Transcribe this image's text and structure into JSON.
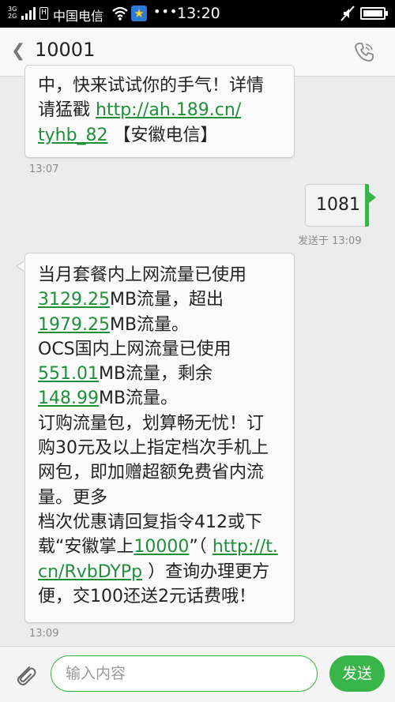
{
  "status_bar": {
    "network_top": "3G",
    "network_bottom": "2G",
    "sim_label": "H",
    "carrier": "中国电信",
    "more": "•••",
    "time": "13:20"
  },
  "header": {
    "back_icon": "chevron-left",
    "title": "10001",
    "call_icon": "phone-icon"
  },
  "messages": {
    "incoming_1": {
      "lines": [
        {
          "text": "中，快来试试你的手气！详情"
        },
        {
          "pre": "请猛戳 ",
          "link": "http://ah.189.cn/"
        },
        {
          "link": "tyhb_82",
          "post": " 【安徽电信】"
        }
      ],
      "timestamp": "13:07"
    },
    "outgoing_1": {
      "text": "1081",
      "timestamp": "发送于 13:09"
    },
    "incoming_2": {
      "lines": [
        {
          "text": "当月套餐内上网流量已使用"
        },
        {
          "link": "3129.25",
          "post": "MB流量，超出"
        },
        {
          "link": "1979.25",
          "post": "MB流量。"
        },
        {
          "text": "OCS国内上网流量已使用"
        },
        {
          "link": "551.01",
          "post": "MB流量，剩余"
        },
        {
          "link": "148.99",
          "post": "MB流量。"
        },
        {
          "text": "订购流量包，划算畅无忧！订"
        },
        {
          "text": "购30元及以上指定档次手机上"
        },
        {
          "text": "网包，即加赠超额免费省内流"
        },
        {
          "text": "量。更多"
        },
        {
          "text": "档次优惠请回复指令412或下"
        },
        {
          "pre": "载“安徽掌上",
          "link": "10000",
          "post": "”（ ",
          "link2": "http://t."
        },
        {
          "link": "cn/RvbDYPp",
          "post": " ）查询办理更方"
        },
        {
          "text": "便，交100还送2元话费哦！"
        }
      ],
      "timestamp": "13:09"
    }
  },
  "input_bar": {
    "attach_icon": "paperclip-icon",
    "placeholder": "输入内容",
    "send_label": "发送"
  },
  "colors": {
    "accent_green": "#3ab54a",
    "link_green": "#1f8f3a",
    "status_bar_bg": "#000000"
  }
}
